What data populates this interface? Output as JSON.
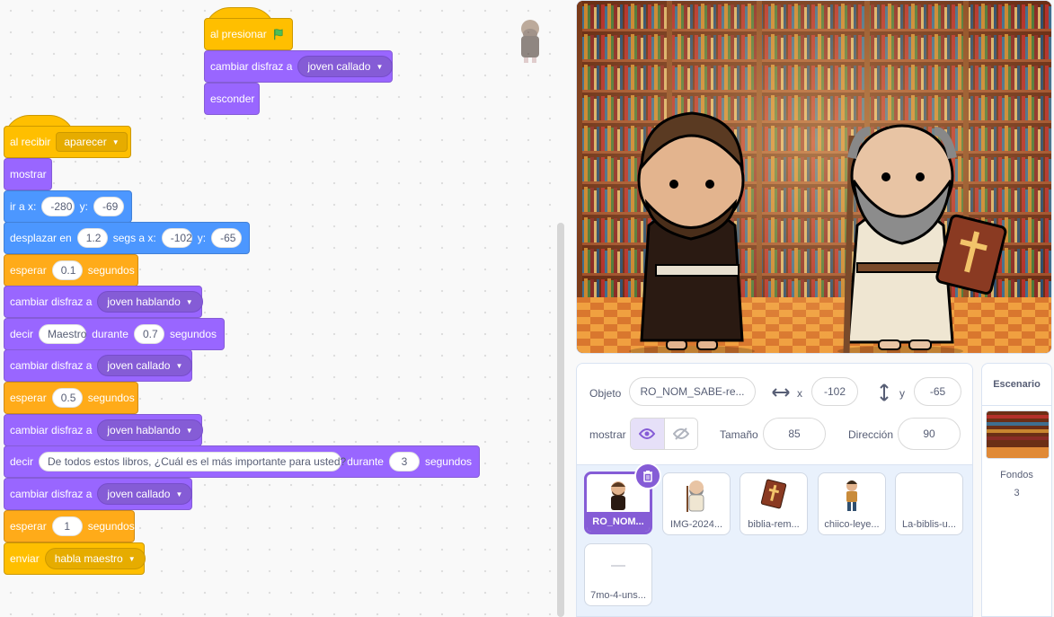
{
  "scripts": {
    "flag": {
      "when_flag": "al presionar",
      "switch_label": "cambiar disfraz a",
      "switch_value": "joven callado",
      "hide": "esconder"
    },
    "receive": {
      "when_receive": "al recibir",
      "message": "aparecer",
      "show": "mostrar",
      "goto_label": "ir a x:",
      "goto_x": "-280",
      "y_label": "y:",
      "goto_y": "-69",
      "glide_label": "desplazar en",
      "glide_secs": "1.2",
      "glide_secs_label": "segs a x:",
      "glide_x": "-102",
      "glide_y": "-65",
      "wait_label": "esperar",
      "wait1": "0.1",
      "seconds": "segundos",
      "switch_label": "cambiar disfraz a",
      "costume_talk": "joven hablando",
      "say_label": "decir",
      "say1_text": "Maestro",
      "for_label": "durante",
      "say1_secs": "0.7",
      "costume_quiet": "joven callado",
      "wait2": "0.5",
      "say2_text": "De todos estos libros, ¿Cuál es el más importante para usted?",
      "say2_secs": "3",
      "wait3": "1",
      "broadcast_label": "enviar",
      "broadcast_msg": "habla maestro"
    }
  },
  "sprite_info": {
    "sprite_label": "Objeto",
    "sprite_name": "RO_NOM_SABE-re...",
    "x_label": "x",
    "x": "-102",
    "y_label": "y",
    "y": "-65",
    "show_label": "mostrar",
    "size_label": "Tamaño",
    "size": "85",
    "direction_label": "Dirección",
    "direction": "90"
  },
  "sprites": [
    {
      "name": "RO_NOM...",
      "selected": true,
      "icon": "young-man-icon"
    },
    {
      "name": "IMG-2024...",
      "selected": false,
      "icon": "old-man-icon"
    },
    {
      "name": "biblia-rem...",
      "selected": false,
      "icon": "bible-icon"
    },
    {
      "name": "chiico-leye...",
      "selected": false,
      "icon": "boy-icon"
    },
    {
      "name": "La-biblis-u...",
      "selected": false,
      "icon": "blank-icon"
    },
    {
      "name": "7mo-4-uns...",
      "selected": false,
      "icon": "blank-icon"
    }
  ],
  "stage_panel": {
    "title": "Escenario",
    "backdrops_label": "Fondos",
    "backdrops_count": "3"
  },
  "colors": {
    "looks": "#9966ff",
    "motion": "#4c97ff",
    "control": "#ffab19",
    "events": "#ffbf00",
    "accent": "#855cd6"
  }
}
